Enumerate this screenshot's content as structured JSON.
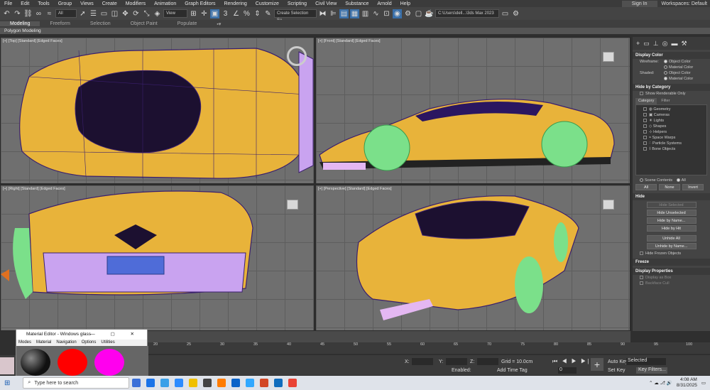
{
  "menu": [
    "File",
    "Edit",
    "Tools",
    "Group",
    "Views",
    "Create",
    "Modifiers",
    "Animation",
    "Graph Editors",
    "Rendering",
    "Customize",
    "Scripting",
    "Civil View",
    "Substance",
    "Arnold",
    "Help"
  ],
  "signin_label": "Sign In",
  "workspaces_label": "Workspaces: Default",
  "toolbar": {
    "filter_value": "All",
    "view_value": "View",
    "selection_set_placeholder": "Create Selection Se",
    "path_value": "C:\\Users\\dell...\\3ds Max 2023"
  },
  "ribbon": {
    "tabs": [
      "Modeling",
      "Freeform",
      "Selection",
      "Object Paint",
      "Populate"
    ],
    "subpanel": "Polygon Modeling"
  },
  "viewports": {
    "top": "[+] [Top] [Standard] [Edged Faces]",
    "front": "[+] [Front] [Standard] [Edged Faces]",
    "right": "[+] [Right] [Standard] [Edged Faces]",
    "perspective": "[+] [Perspective] [Standard] [Edged Faces]"
  },
  "command_panel": {
    "display_color": {
      "title": "Display Color",
      "wireframe_label": "Wireframe:",
      "shaded_label": "Shaded:",
      "object_color": "Object Color",
      "material_color": "Material Color"
    },
    "hide_by_category": {
      "title": "Hide by Category",
      "show_renderable": "Show Renderable Only",
      "tab_category": "Category",
      "tab_filter": "Filter",
      "items": [
        "Geometry",
        "Cameras",
        "Lights",
        "Shapes",
        "Helpers",
        "Space Warps",
        "Particle Systems",
        "Bone Objects"
      ]
    },
    "scene_contents": "Scene Contents",
    "all_radio": "All",
    "buttons_row": [
      "All",
      "None",
      "Invert"
    ],
    "hide": {
      "title": "Hide",
      "buttons": [
        "Hide Selected",
        "Hide Unselected",
        "Hide by Name...",
        "Hide by Hit",
        "Unhide All",
        "Unhide by Name..."
      ],
      "hide_frozen": "Hide Frozen Objects"
    },
    "freeze_title": "Freeze",
    "display_properties_title": "Display Properties",
    "display_properties_items": [
      "Display as Box",
      "Backface Cull"
    ]
  },
  "timeline": {
    "ticks": [
      "20",
      "25",
      "30",
      "35",
      "40",
      "45",
      "50",
      "55",
      "60",
      "65",
      "70",
      "75",
      "80",
      "85",
      "90",
      "95",
      "100"
    ]
  },
  "status": {
    "x_label": "X:",
    "y_label": "Y:",
    "z_label": "Z:",
    "grid": "Grid = 10.0cm",
    "enabled": "Enabled:",
    "add_time_tag": "Add Time Tag",
    "auto_key": "Auto Key",
    "selected": "Selected",
    "set_key": "Set Key",
    "key_filters": "Key Filters...",
    "frame": "0"
  },
  "material_editor": {
    "title": "Material Editor - Windows glass",
    "menu": [
      "Modes",
      "Material",
      "Navigation",
      "Options",
      "Utilities"
    ]
  },
  "taskbar": {
    "search_placeholder": "Type here to search",
    "time": "4:08 AM",
    "date": "8/31/2025"
  },
  "colors": {
    "car_body": "#e8b33a",
    "wire": "#3a1f6e",
    "wheel": "#7be08a",
    "accent": "#3a6fa8"
  }
}
